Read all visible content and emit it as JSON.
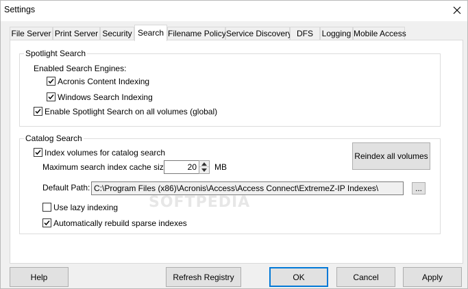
{
  "window": {
    "title": "Settings"
  },
  "tabs": [
    {
      "label": "File Server"
    },
    {
      "label": "Print Server"
    },
    {
      "label": "Security"
    },
    {
      "label": "Search",
      "active": true
    },
    {
      "label": "Filename Policy"
    },
    {
      "label": "Service Discovery"
    },
    {
      "label": "DFS"
    },
    {
      "label": "Logging"
    },
    {
      "label": "Mobile Access"
    }
  ],
  "spotlight": {
    "title": "Spotlight Search",
    "engines_label": "Enabled Search Engines:",
    "acronis": {
      "label": "Acronis Content Indexing",
      "checked": true
    },
    "windows": {
      "label": "Windows Search Indexing",
      "checked": true
    },
    "global": {
      "label": "Enable Spotlight Search on all volumes (global)",
      "checked": true
    }
  },
  "catalog": {
    "title": "Catalog Search",
    "index_volumes": {
      "label": "Index volumes for catalog search",
      "checked": true
    },
    "reindex_label": "Reindex all volumes",
    "cache_label": "Maximum search index cache size",
    "cache_value": "20",
    "cache_unit": "MB",
    "path_label": "Default Path:",
    "path_value": "C:\\Program Files (x86)\\Acronis\\Access\\Access Connect\\ExtremeZ-IP Indexes\\",
    "browse_label": "...",
    "lazy": {
      "label": "Use lazy indexing",
      "checked": false
    },
    "rebuild": {
      "label": "Automatically rebuild sparse indexes",
      "checked": true
    }
  },
  "watermark": "SOFTPEDIA",
  "footer": {
    "help": "Help",
    "refresh": "Refresh Registry",
    "ok": "OK",
    "cancel": "Cancel",
    "apply": "Apply"
  }
}
